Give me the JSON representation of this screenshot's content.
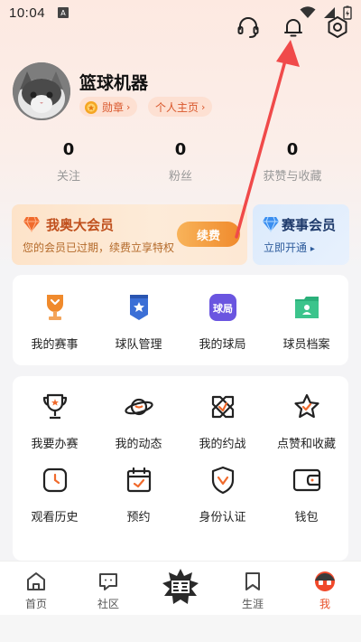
{
  "status_bar": {
    "time": "10:04",
    "sim_label": "A"
  },
  "header": {
    "icons": [
      "headset-icon",
      "bell-icon",
      "settings-icon"
    ]
  },
  "profile": {
    "username": "篮球机器",
    "badge_label": "勋章",
    "homepage_label": "个人主页",
    "chevron": "›"
  },
  "stats": [
    {
      "value": "0",
      "label": "关注"
    },
    {
      "value": "0",
      "label": "粉丝"
    },
    {
      "value": "0",
      "label": "获赞与收藏"
    }
  ],
  "vip": {
    "title": "我奥大会员",
    "subtitle": "您的会员已过期，续费立享特权",
    "button": "续费"
  },
  "event_member": {
    "title": "赛事会员",
    "subtitle": "立即开通",
    "arrow": "▸"
  },
  "quick_menu": [
    {
      "label": "我的赛事",
      "icon": "trophy-icon"
    },
    {
      "label": "球队管理",
      "icon": "team-shield-icon"
    },
    {
      "label": "我的球局",
      "icon": "game-badge-icon"
    },
    {
      "label": "球员档案",
      "icon": "player-file-icon"
    }
  ],
  "services": [
    {
      "label": "我要办赛",
      "icon": "cup-icon"
    },
    {
      "label": "我的动态",
      "icon": "planet-icon"
    },
    {
      "label": "我的约战",
      "icon": "crossed-swords-icon"
    },
    {
      "label": "点赞和收藏",
      "icon": "star-icon"
    },
    {
      "label": "观看历史",
      "icon": "clock-icon"
    },
    {
      "label": "预约",
      "icon": "calendar-icon"
    },
    {
      "label": "身份认证",
      "icon": "verify-shield-icon"
    },
    {
      "label": "钱包",
      "icon": "wallet-icon"
    }
  ],
  "tabbar": [
    {
      "label": "首页",
      "icon": "home-icon"
    },
    {
      "label": "社区",
      "icon": "community-icon"
    },
    {
      "label": "",
      "icon": "center-logo-icon"
    },
    {
      "label": "生涯",
      "icon": "career-bookmark-icon"
    },
    {
      "label": "我",
      "icon": "me-face-icon"
    }
  ],
  "colors": {
    "accent": "#e8512a",
    "vip_text": "#c0501d",
    "event_text": "#1e3a6b",
    "annotation": "#f04a4a"
  }
}
